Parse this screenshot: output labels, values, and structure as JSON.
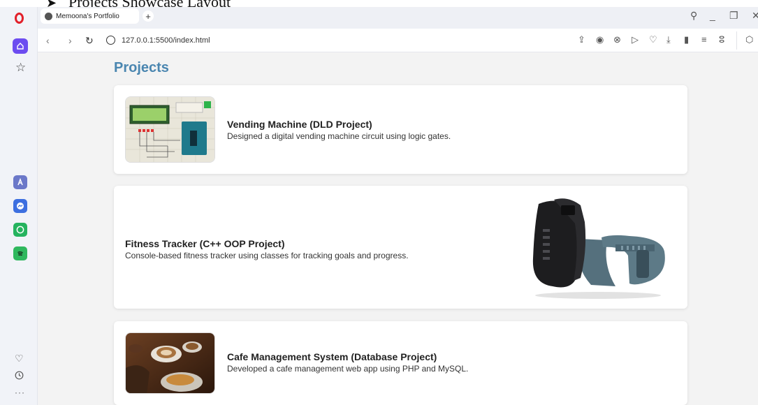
{
  "doc_caption": "Projects Showcase Layout",
  "browser": {
    "tab_title": "Memoona's Portfolio",
    "url": "127.0.0.1:5500/index.html"
  },
  "page": {
    "section_title": "Projects",
    "projects": [
      {
        "title": "Vending Machine (DLD Project)",
        "description": "Designed a digital vending machine circuit using logic gates."
      },
      {
        "title": "Fitness Tracker (C++ OOP Project)",
        "description": "Console-based fitness tracker using classes for tracking goals and progress."
      },
      {
        "title": "Cafe Management System (Database Project)",
        "description": "Developed a cafe management web app using PHP and MySQL."
      }
    ]
  },
  "icons": {
    "sidebar": [
      "opera-logo",
      "home-icon",
      "star-icon",
      "aria-icon",
      "messenger-icon",
      "whatsapp-icon",
      "spotify-icon",
      "heart-icon",
      "history-icon",
      "more-icon"
    ],
    "toolbar": [
      "share-icon",
      "camera-icon",
      "shield-icon",
      "play-icon",
      "heart-icon",
      "download-icon",
      "battery-icon",
      "menu-icon",
      "profile-icon",
      "extensions-icon"
    ]
  },
  "colors": {
    "accent": "#4a86b0",
    "opera_red": "#e2202a",
    "home_purple": "#6c4cf0"
  }
}
